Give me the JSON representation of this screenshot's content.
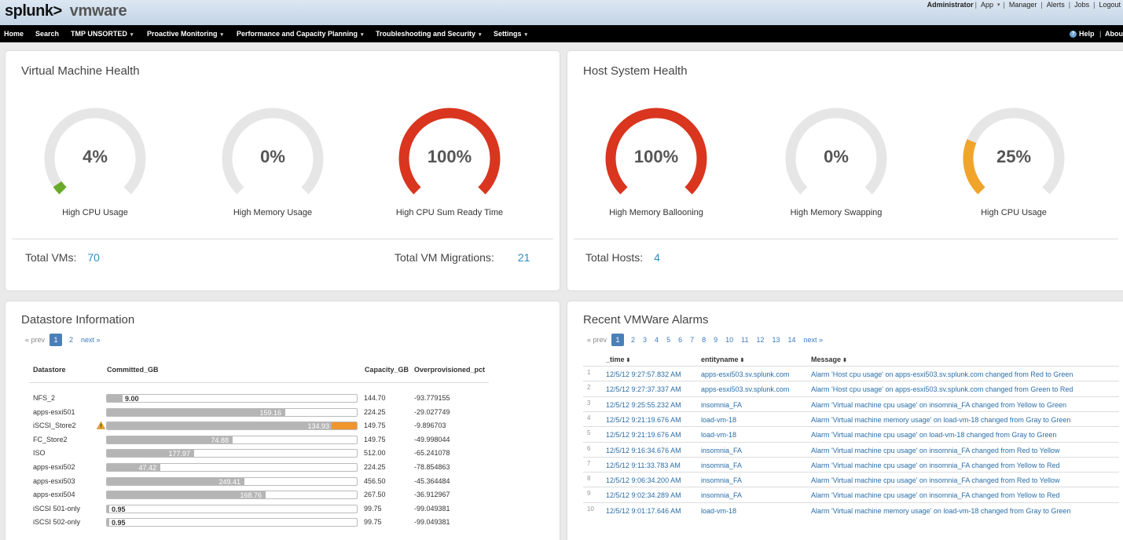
{
  "header": {
    "brand_splunk": "splunk>",
    "brand_vmware": "vmware",
    "user": "Administrator",
    "links": [
      "App",
      "Manager",
      "Alerts",
      "Jobs",
      "Logout"
    ]
  },
  "nav": {
    "items": [
      {
        "label": "Home",
        "has_menu": false
      },
      {
        "label": "Search",
        "has_menu": false
      },
      {
        "label": "TMP UNSORTED",
        "has_menu": true
      },
      {
        "label": "Proactive Monitoring",
        "has_menu": true
      },
      {
        "label": "Performance and Capacity Planning",
        "has_menu": true
      },
      {
        "label": "Troubleshooting and Security",
        "has_menu": true
      },
      {
        "label": "Settings",
        "has_menu": true
      }
    ],
    "help": "Help",
    "about": "About"
  },
  "colors": {
    "red": "#d9351f",
    "green": "#6aaa2a",
    "orange": "#f0a52a",
    "track": "#e6e6e6",
    "link": "#2b8ec3"
  },
  "vm_health": {
    "title": "Virtual Machine Health",
    "gauges": [
      {
        "value": "4%",
        "pct": 4,
        "label": "High CPU Usage",
        "color": "green"
      },
      {
        "value": "0%",
        "pct": 0,
        "label": "High Memory Usage",
        "color": "green"
      },
      {
        "value": "100%",
        "pct": 100,
        "label": "High CPU Sum Ready Time",
        "color": "red"
      }
    ],
    "total_vms_label": "Total VMs:",
    "total_vms": "70",
    "total_migrations_label": "Total VM Migrations:",
    "total_migrations": "21"
  },
  "host_health": {
    "title": "Host System Health",
    "gauges": [
      {
        "value": "100%",
        "pct": 100,
        "label": "High Memory Ballooning",
        "color": "red"
      },
      {
        "value": "0%",
        "pct": 0,
        "label": "High Memory Swapping",
        "color": "green"
      },
      {
        "value": "25%",
        "pct": 25,
        "label": "High CPU Usage",
        "color": "orange"
      }
    ],
    "total_hosts_label": "Total Hosts:",
    "total_hosts": "4"
  },
  "datastore": {
    "title": "Datastore Information",
    "pager": {
      "prev": "« prev",
      "pages": [
        "1",
        "2"
      ],
      "current": "1",
      "next": "next »"
    },
    "columns": [
      "Datastore",
      "Committed_GB",
      "Capacity_GB",
      "Overprovisioned_pct"
    ],
    "rows": [
      {
        "name": "NFS_2",
        "committed": "9.00",
        "capacity": "144.70",
        "over": "-93.779155",
        "fill": 0.062,
        "excess": 0
      },
      {
        "name": "apps-esxi501",
        "committed": "159.16",
        "capacity": "224.25",
        "over": "-29.027749",
        "fill": 0.71,
        "excess": 0
      },
      {
        "name": "iSCSI_Store2",
        "committed": "134.93",
        "capacity": "149.75",
        "over": "-9.896703",
        "fill": 0.9,
        "excess": 0.1,
        "warning": true
      },
      {
        "name": "FC_Store2",
        "committed": "74.88",
        "capacity": "149.75",
        "over": "-49.998044",
        "fill": 0.5,
        "excess": 0
      },
      {
        "name": "ISO",
        "committed": "177.97",
        "capacity": "512.00",
        "over": "-65.241078",
        "fill": 0.348,
        "excess": 0
      },
      {
        "name": "apps-esxi502",
        "committed": "47.42",
        "capacity": "224.25",
        "over": "-78.854863",
        "fill": 0.212,
        "excess": 0
      },
      {
        "name": "apps-esxi503",
        "committed": "249.41",
        "capacity": "456.50",
        "over": "-45.364484",
        "fill": 0.546,
        "excess": 0
      },
      {
        "name": "apps-esxi504",
        "committed": "168.76",
        "capacity": "267.50",
        "over": "-36.912967",
        "fill": 0.631,
        "excess": 0
      },
      {
        "name": "iSCSI 501-only",
        "committed": "0.95",
        "capacity": "99.75",
        "over": "-99.049381",
        "fill": 0.01,
        "excess": 0
      },
      {
        "name": "iSCSI 502-only",
        "committed": "0.95",
        "capacity": "99.75",
        "over": "-99.049381",
        "fill": 0.01,
        "excess": 0
      }
    ]
  },
  "alarms": {
    "title": "Recent VMWare Alarms",
    "pager": {
      "prev": "« prev",
      "pages": [
        "1",
        "2",
        "3",
        "4",
        "5",
        "6",
        "7",
        "8",
        "9",
        "10",
        "11",
        "12",
        "13",
        "14"
      ],
      "current": "1",
      "next": "next »"
    },
    "columns": [
      "_time",
      "entityname",
      "Message"
    ],
    "rows": [
      {
        "idx": "1",
        "time": "12/5/12 9:27:57.832 AM",
        "entity": "apps-esxi503.sv.splunk.com",
        "message": "Alarm 'Host cpu usage' on apps-esxi503.sv.splunk.com changed from Red to Green"
      },
      {
        "idx": "2",
        "time": "12/5/12 9:27:37.337 AM",
        "entity": "apps-esxi503.sv.splunk.com",
        "message": "Alarm 'Host cpu usage' on apps-esxi503.sv.splunk.com changed from Green to Red"
      },
      {
        "idx": "3",
        "time": "12/5/12 9:25:55.232 AM",
        "entity": "insomnia_FA",
        "message": "Alarm 'Virtual machine cpu usage' on insomnia_FA changed from Yellow to Green"
      },
      {
        "idx": "4",
        "time": "12/5/12 9:21:19.676 AM",
        "entity": "load-vm-18",
        "message": "Alarm 'Virtual machine memory usage' on load-vm-18 changed from Gray to Green"
      },
      {
        "idx": "5",
        "time": "12/5/12 9:21:19.676 AM",
        "entity": "load-vm-18",
        "message": "Alarm 'Virtual machine cpu usage' on load-vm-18 changed from Gray to Green"
      },
      {
        "idx": "6",
        "time": "12/5/12 9:16:34.676 AM",
        "entity": "insomnia_FA",
        "message": "Alarm 'Virtual machine cpu usage' on insomnia_FA changed from Red to Yellow"
      },
      {
        "idx": "7",
        "time": "12/5/12 9:11:33.783 AM",
        "entity": "insomnia_FA",
        "message": "Alarm 'Virtual machine cpu usage' on insomnia_FA changed from Yellow to Red"
      },
      {
        "idx": "8",
        "time": "12/5/12 9:06:34.200 AM",
        "entity": "insomnia_FA",
        "message": "Alarm 'Virtual machine cpu usage' on insomnia_FA changed from Red to Yellow"
      },
      {
        "idx": "9",
        "time": "12/5/12 9:02:34.289 AM",
        "entity": "insomnia_FA",
        "message": "Alarm 'Virtual machine cpu usage' on insomnia_FA changed from Yellow to Red"
      },
      {
        "idx": "10",
        "time": "12/5/12 9:01:17.646 AM",
        "entity": "load-vm-18",
        "message": "Alarm 'Virtual machine memory usage' on load-vm-18 changed from Gray to Green"
      }
    ]
  }
}
